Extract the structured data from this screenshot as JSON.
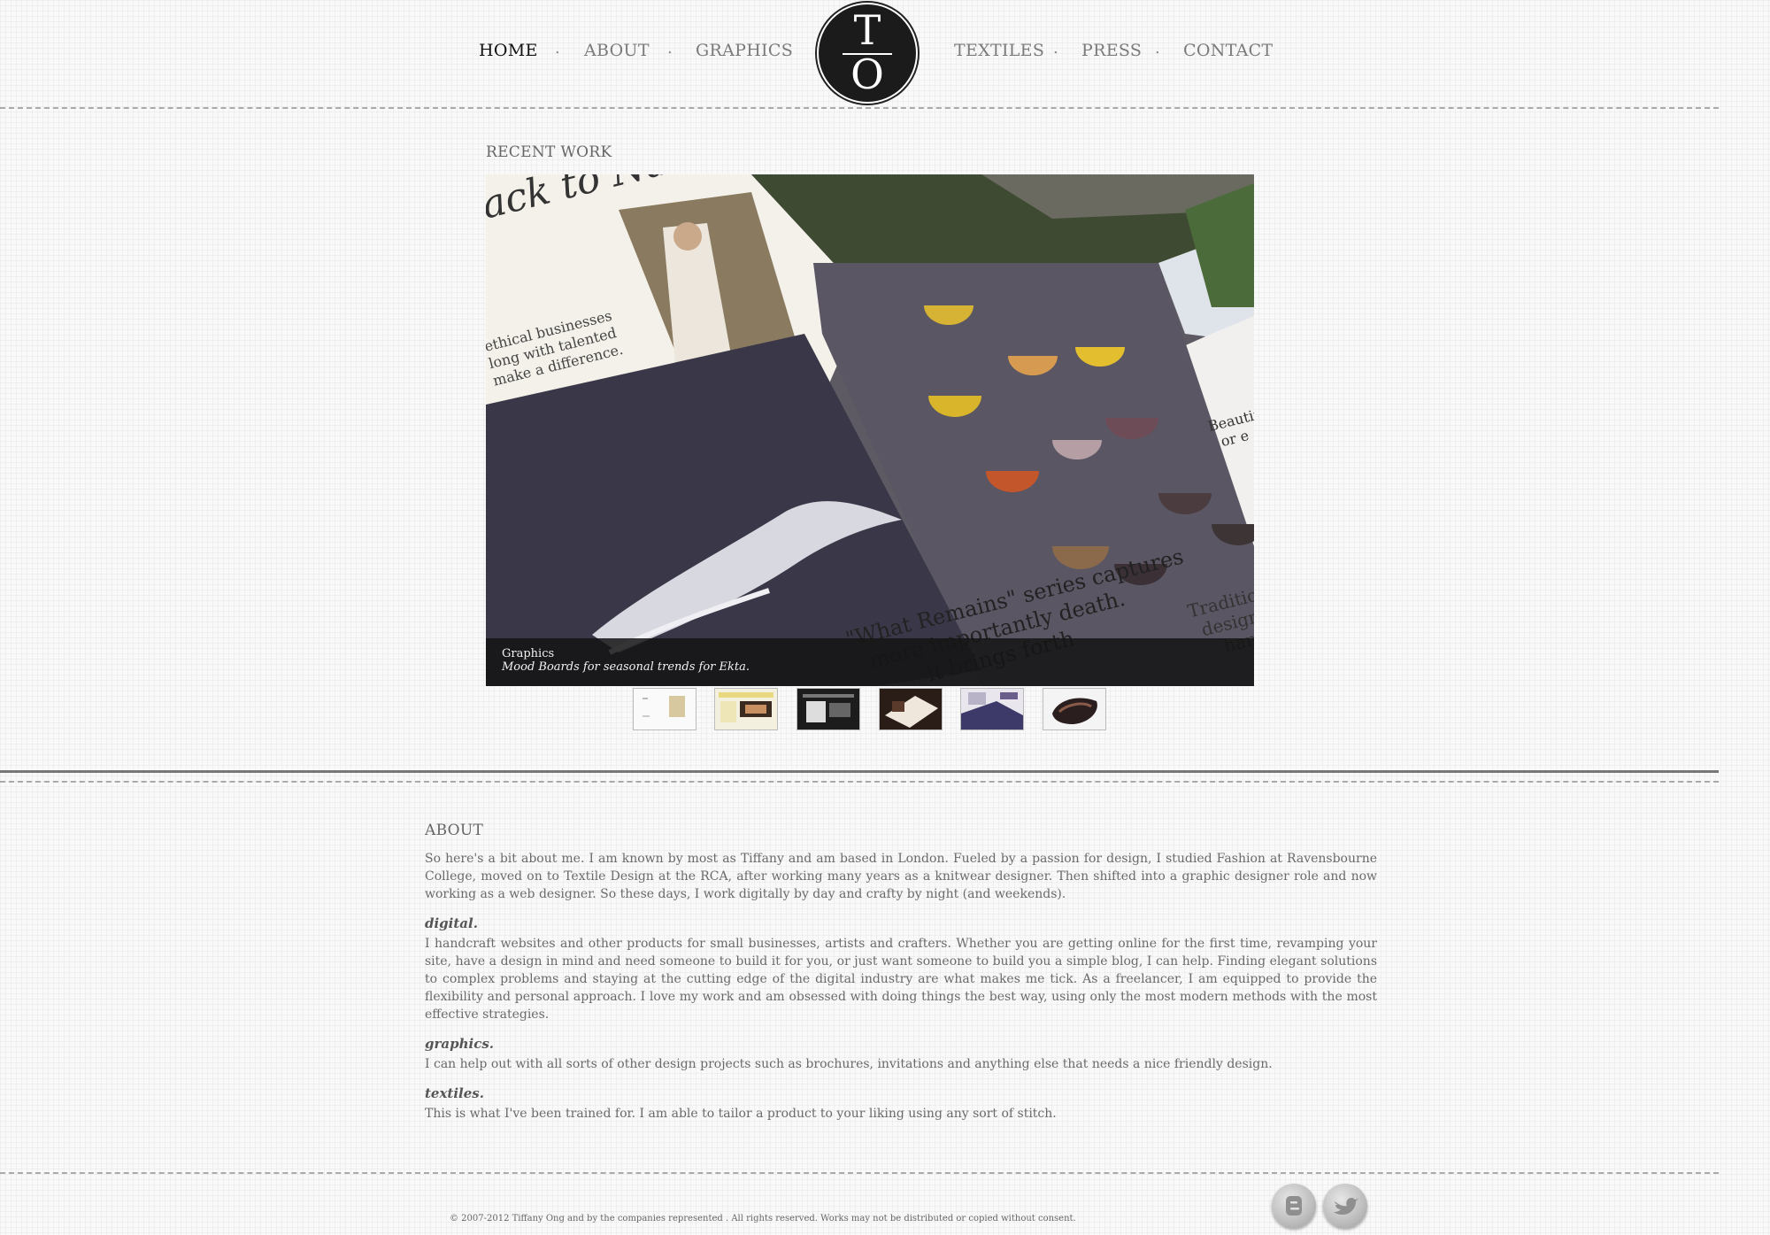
{
  "nav": {
    "items": [
      {
        "label": "HOME"
      },
      {
        "label": "ABOUT"
      },
      {
        "label": "GRAPHICS"
      },
      {
        "label": "TEXTILES"
      },
      {
        "label": "PRESS"
      },
      {
        "label": "CONTACT"
      }
    ],
    "separator": ".",
    "logo": {
      "top_letter": "T",
      "bottom_letter": "O"
    }
  },
  "recent_work": {
    "heading": "RECENT WORK",
    "slide_text": {
      "headline": "ack to Natu",
      "blurb": [
        "ethical businesses",
        "long with talented",
        "make a difference."
      ],
      "quote": [
        "\"What Remains\" series captures",
        "more importantly death.",
        "it brings forth"
      ],
      "side": [
        "Beautif",
        "or e"
      ],
      "side2": [
        "Traditio",
        "design",
        "han"
      ]
    },
    "caption": {
      "title": "Graphics",
      "description": "Mood Boards for seasonal trends for Ekta."
    },
    "thumbnails": [
      {
        "icon": "thumb-white-page"
      },
      {
        "icon": "thumb-yellow-web"
      },
      {
        "icon": "thumb-dark-web"
      },
      {
        "icon": "thumb-brown-board"
      },
      {
        "icon": "thumb-purple-print"
      },
      {
        "icon": "thumb-black-bag"
      }
    ]
  },
  "about": {
    "heading": "ABOUT",
    "intro": "So here's a bit about me. I am known by most as Tiffany and am based in London. Fueled by a passion for design, I studied Fashion at Ravensbourne College, moved on to Textile Design at the RCA, after working many years as a knitwear designer. Then shifted into a graphic designer role and now working as a web designer. So these days, I work digitally by day and crafty by night (and weekends).",
    "sections": [
      {
        "title": "digital.",
        "text": "I handcraft websites and other products for small businesses, artists and crafters. Whether you are getting online for the first time, revamping your site, have a design in mind and need someone to build it for you, or just want someone to build you a simple blog, I can help. Finding elegant solutions to complex problems and staying at the cutting edge of the digital industry are what makes me tick. As a freelancer, I am equipped to provide the flexibility and personal approach. I love my work and am obsessed with doing things the best way, using only the most modern methods with the most effective strategies."
      },
      {
        "title": "graphics.",
        "text": "I can help out with all sorts of other design projects such as brochures, invitations and anything else that needs a nice friendly design."
      },
      {
        "title": "textiles.",
        "text": "This is what I've been trained for. I am able to tailor a product to your liking using any sort of stitch."
      }
    ]
  },
  "footer": {
    "copyright": "© 2007-2012 Tiffany Ong and by the companies represented . All rights reserved. Works may not be distributed or copied without consent.",
    "social": [
      {
        "icon": "blogger-icon"
      },
      {
        "icon": "twitter-icon"
      }
    ]
  },
  "colors": {
    "background": "#f9f9f9",
    "text": "#666666",
    "active_nav": "#111111",
    "logo": "#1b1b1b",
    "caption_bg": "#141414"
  }
}
